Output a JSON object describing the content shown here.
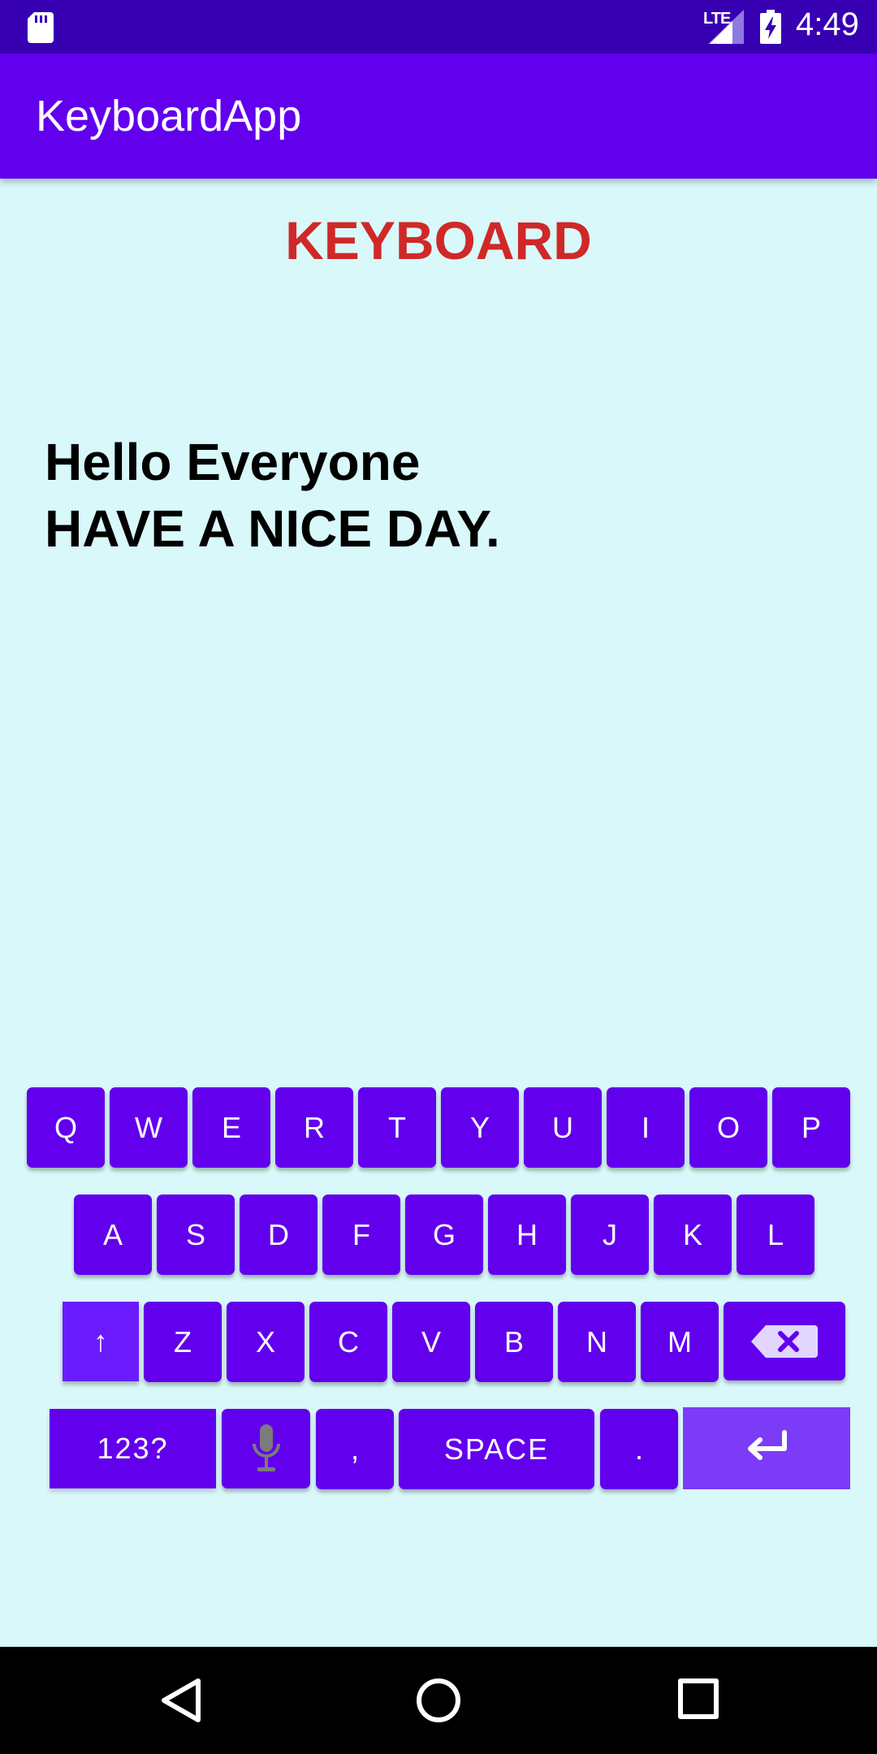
{
  "status_bar": {
    "network": "LTE",
    "time": "4:49"
  },
  "app_bar": {
    "title": "KeyboardApp"
  },
  "main": {
    "heading": "KEYBOARD",
    "lines": [
      "Hello Everyone",
      "HAVE A NICE DAY."
    ]
  },
  "keyboard": {
    "row1": [
      "Q",
      "W",
      "E",
      "R",
      "T",
      "Y",
      "U",
      "I",
      "O",
      "P"
    ],
    "row2": [
      "A",
      "S",
      "D",
      "F",
      "G",
      "H",
      "J",
      "K",
      "L"
    ],
    "row3": {
      "shift": "↑",
      "letters": [
        "Z",
        "X",
        "C",
        "V",
        "B",
        "N",
        "M"
      ]
    },
    "row4": {
      "mode": "123?",
      "comma": ",",
      "space": "SPACE",
      "period": "."
    }
  },
  "colors": {
    "status_bar": "#3700b3",
    "app_bar": "#6200ee",
    "background": "#d9f8f9",
    "heading": "#d02828",
    "key": "#6200ee",
    "enter_key": "#7c3bf6"
  },
  "icons": [
    "sd-card-icon",
    "signal-icon",
    "battery-charging-icon",
    "microphone-icon",
    "backspace-icon",
    "enter-icon",
    "back-icon",
    "home-icon",
    "recents-icon"
  ]
}
